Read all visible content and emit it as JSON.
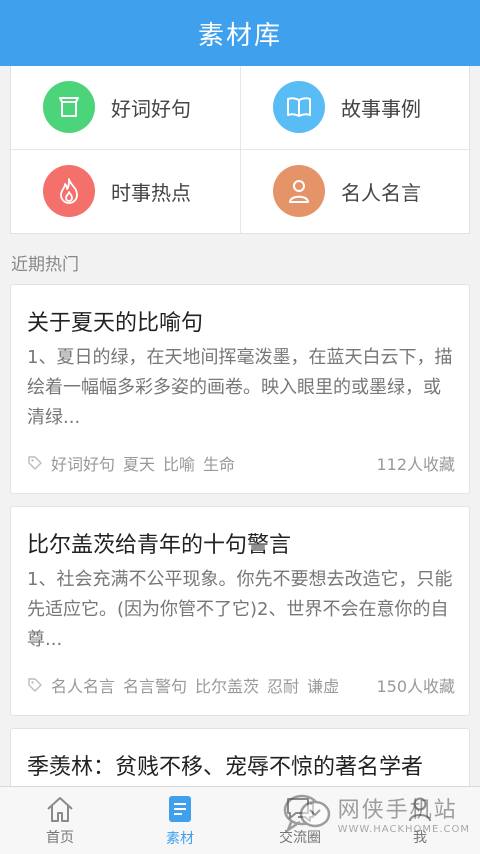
{
  "header": {
    "title": "素材库"
  },
  "categories": [
    {
      "label": "好词好句",
      "icon": "box-icon",
      "color": "#4cd47a"
    },
    {
      "label": "故事事例",
      "icon": "book-icon",
      "color": "#59bcf4"
    },
    {
      "label": "时事热点",
      "icon": "flame-icon",
      "color": "#f4706b"
    },
    {
      "label": "名人名言",
      "icon": "person-icon",
      "color": "#e5946a"
    }
  ],
  "section": {
    "label": "近期热门"
  },
  "cards": [
    {
      "title": "关于夏天的比喻句",
      "excerpt": "1、夏日的绿，在天地间挥毫泼墨，在蓝天白云下，描绘着一幅幅多彩多姿的画卷。映入眼里的或墨绿，或清绿...",
      "tags": [
        "好词好句",
        "夏天",
        "比喻",
        "生命"
      ],
      "favorites": "112人收藏"
    },
    {
      "title": "比尔盖茨给青年的十句警言",
      "excerpt": "1、社会充满不公平现象。你先不要想去改造它，只能先适应它。(因为你管不了它)2、世界不会在意你的自尊...",
      "tags": [
        "名人名言",
        "名言警句",
        "比尔盖茨",
        "忍耐",
        "谦虚"
      ],
      "favorites": "150人收藏"
    },
    {
      "title": "季羡林：贫贱不移、宠辱不惊的著名学者"
    }
  ],
  "tabbar": {
    "tabs": [
      {
        "label": "首页",
        "icon": "home-icon",
        "active": false
      },
      {
        "label": "素材",
        "icon": "document-icon",
        "active": true
      },
      {
        "label": "交流圈",
        "icon": "chat-icon",
        "active": false
      },
      {
        "label": "我",
        "icon": "profile-icon",
        "active": false
      }
    ]
  },
  "watermark": {
    "text": "网侠手机站",
    "url": "WWW.HACKHOME.COM"
  },
  "colors": {
    "accent": "#3fa0ee"
  }
}
